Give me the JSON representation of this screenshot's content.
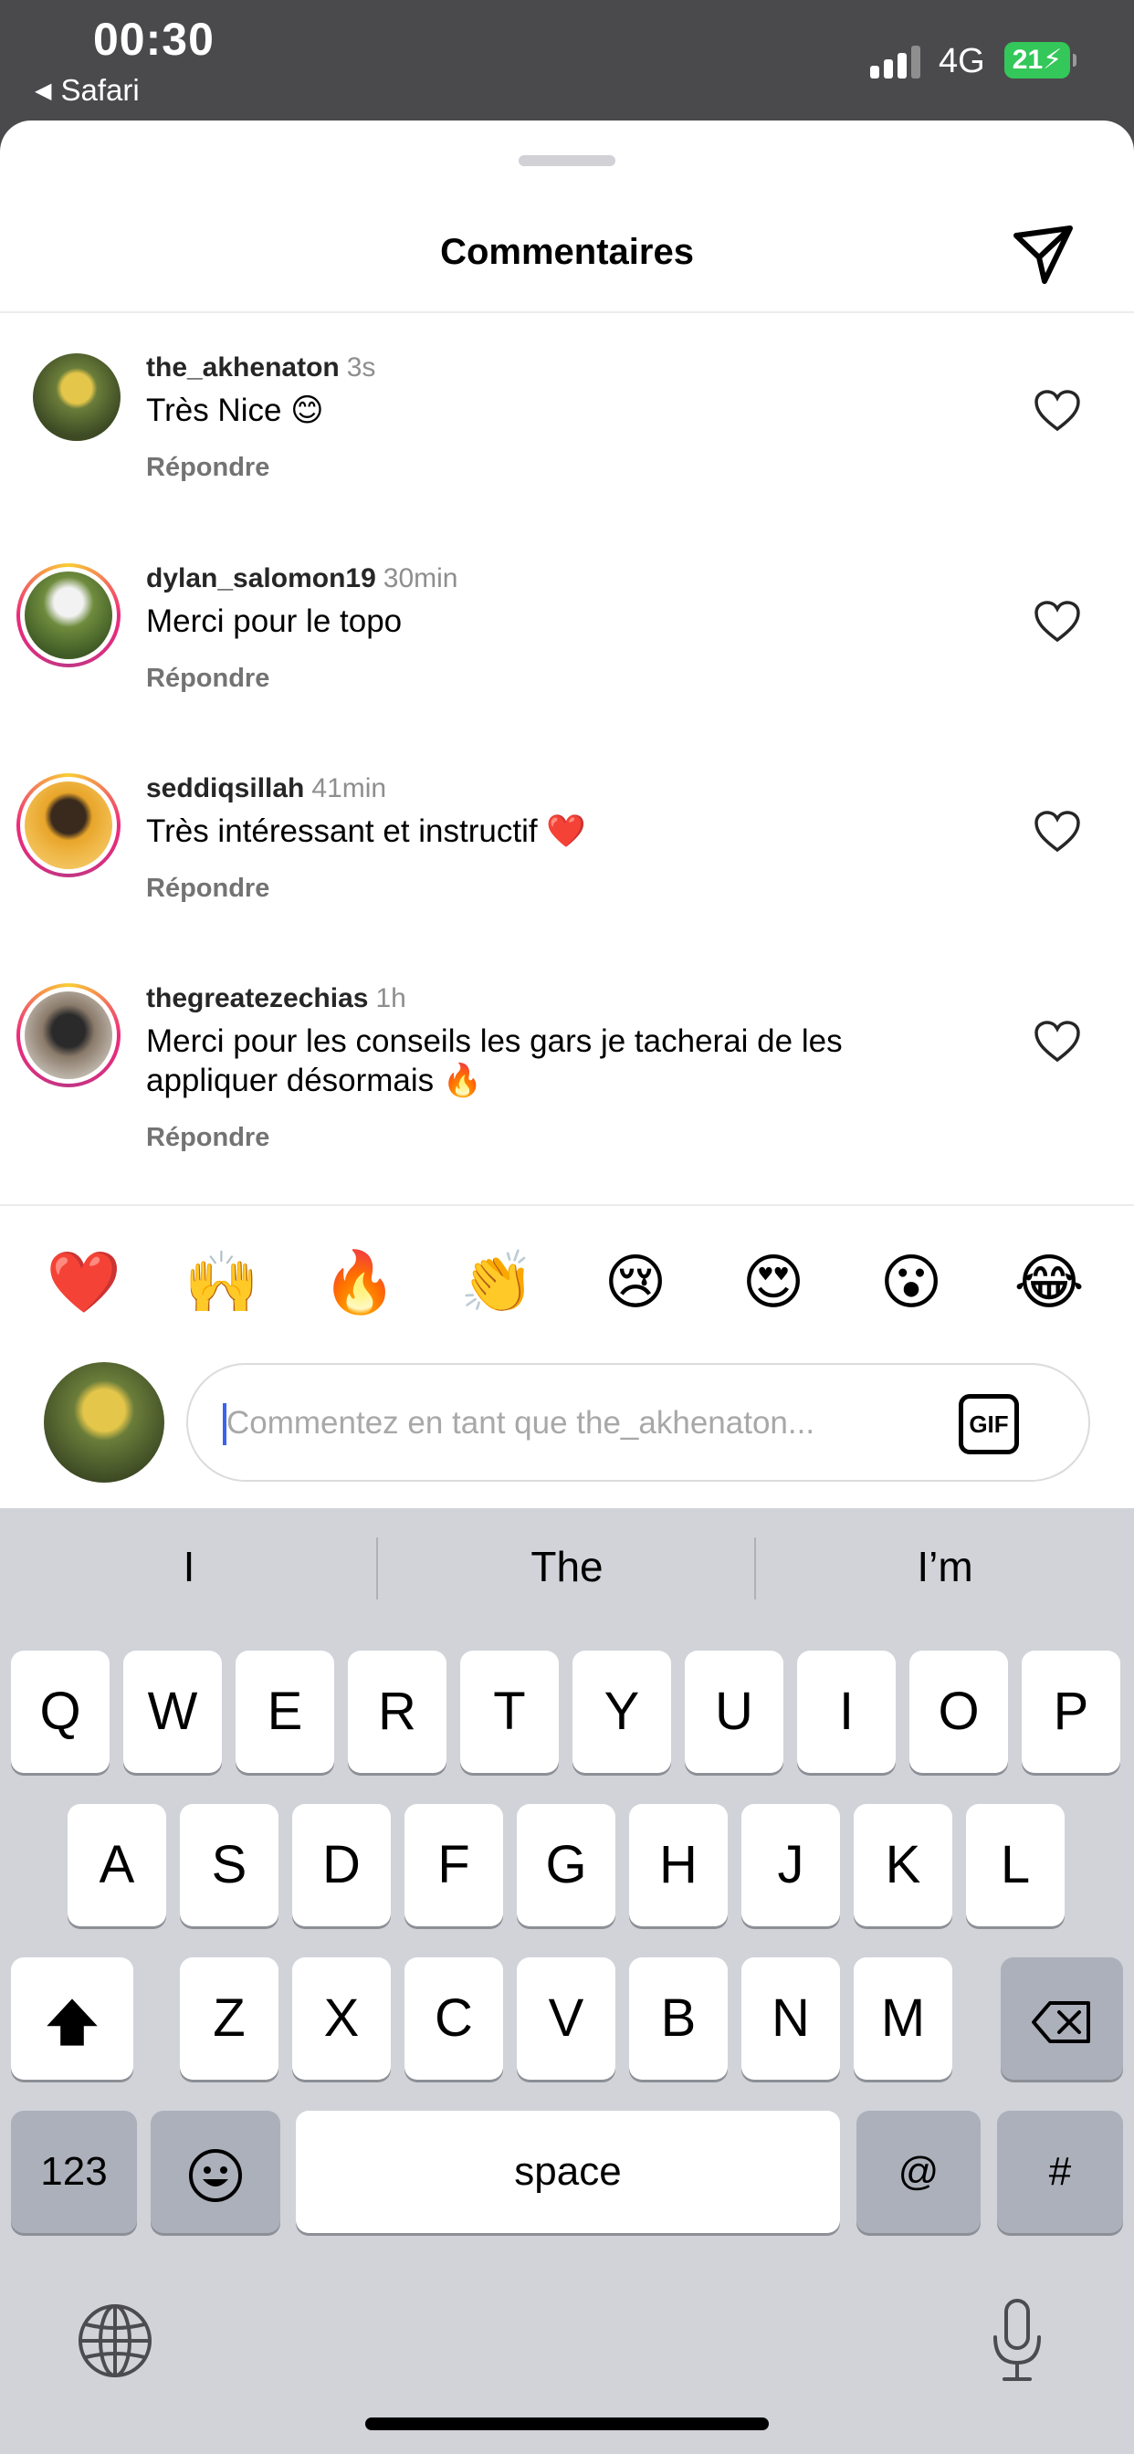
{
  "status_bar": {
    "time": "00:30",
    "back_app": "Safari",
    "back_glyph": "◀",
    "network": "4G",
    "battery": "21"
  },
  "sheet": {
    "title": "Commentaires",
    "share_icon": "paper-plane-icon"
  },
  "comments": [
    {
      "username": "the_akhenaton",
      "time": "3s",
      "text": "Très Nice 😊",
      "reply": "Répondre",
      "ring": false
    },
    {
      "username": "dylan_salomon19",
      "time": "30min",
      "text": "Merci pour le topo",
      "reply": "Répondre",
      "ring": true
    },
    {
      "username": "seddiqsillah",
      "time": "41min",
      "text": "Très intéressant et instructif ❤️",
      "reply": "Répondre",
      "ring": true
    },
    {
      "username": "thegreatezechias",
      "time": "1h",
      "text": "Merci pour les conseils les gars je tacherai de les appliquer désormais 🔥",
      "reply": "Répondre",
      "ring": true
    }
  ],
  "quick_reactions": [
    "❤️",
    "🙌",
    "🔥",
    "👏",
    "😢",
    "😍",
    "😮",
    "😂"
  ],
  "composer": {
    "placeholder": "Commentez en tant que the_akhenaton...",
    "gif_label": "GIF"
  },
  "keyboard": {
    "suggestions": [
      "I",
      "The",
      "I’m"
    ],
    "row1": [
      "Q",
      "W",
      "E",
      "R",
      "T",
      "Y",
      "U",
      "I",
      "O",
      "P"
    ],
    "row2": [
      "A",
      "S",
      "D",
      "F",
      "G",
      "H",
      "J",
      "K",
      "L"
    ],
    "row3": [
      "Z",
      "X",
      "C",
      "V",
      "B",
      "N",
      "M"
    ],
    "numbers_label": "123",
    "space_label": "space",
    "at_label": "@",
    "hash_label": "#"
  },
  "colors": {
    "accent_caret": "#3a62f0",
    "battery": "#34c759",
    "story_ring": "#ee2a7b"
  }
}
